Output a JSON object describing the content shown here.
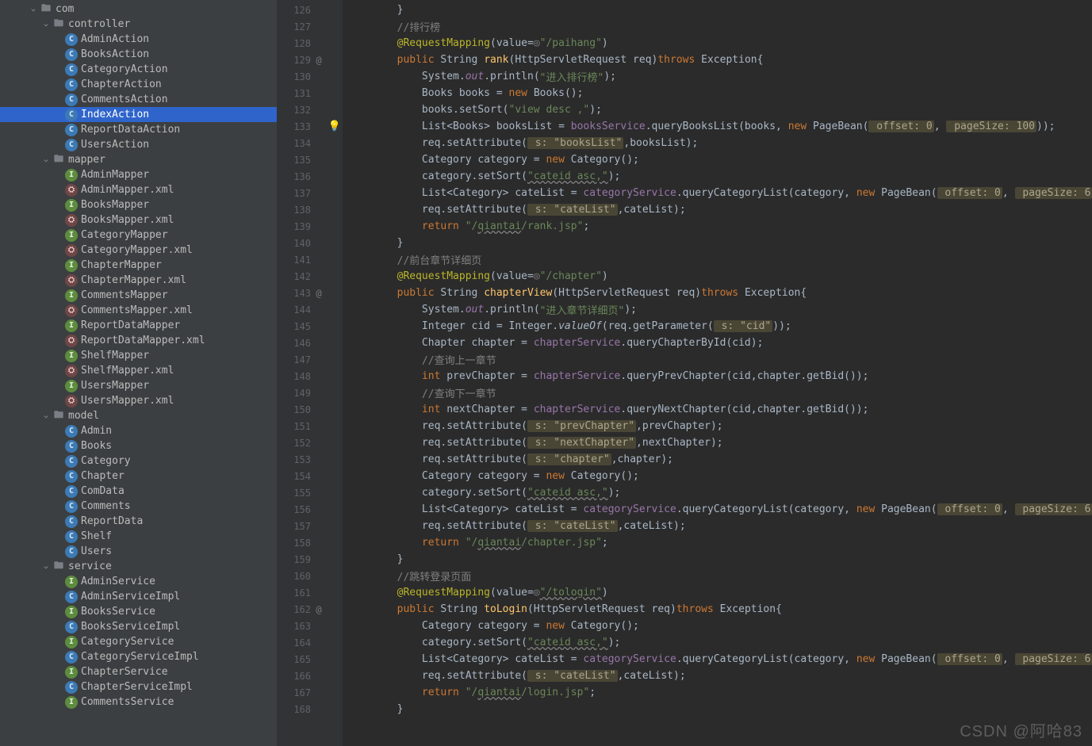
{
  "watermark": "CSDN @阿哈83",
  "tree": [
    {
      "indent": 2,
      "expanded": true,
      "iconType": "folder",
      "label": "com"
    },
    {
      "indent": 3,
      "expanded": true,
      "iconType": "folder",
      "label": "controller"
    },
    {
      "indent": 4,
      "iconType": "class",
      "label": "AdminAction"
    },
    {
      "indent": 4,
      "iconType": "class",
      "label": "BooksAction"
    },
    {
      "indent": 4,
      "iconType": "class",
      "label": "CategoryAction"
    },
    {
      "indent": 4,
      "iconType": "class",
      "label": "ChapterAction"
    },
    {
      "indent": 4,
      "iconType": "class",
      "label": "CommentsAction"
    },
    {
      "indent": 4,
      "iconType": "class",
      "label": "IndexAction",
      "selected": true
    },
    {
      "indent": 4,
      "iconType": "class",
      "label": "ReportDataAction"
    },
    {
      "indent": 4,
      "iconType": "class",
      "label": "UsersAction"
    },
    {
      "indent": 3,
      "expanded": true,
      "iconType": "folder",
      "label": "mapper"
    },
    {
      "indent": 4,
      "iconType": "interface",
      "label": "AdminMapper"
    },
    {
      "indent": 4,
      "iconType": "xml",
      "label": "AdminMapper.xml"
    },
    {
      "indent": 4,
      "iconType": "interface",
      "label": "BooksMapper"
    },
    {
      "indent": 4,
      "iconType": "xml",
      "label": "BooksMapper.xml"
    },
    {
      "indent": 4,
      "iconType": "interface",
      "label": "CategoryMapper"
    },
    {
      "indent": 4,
      "iconType": "xml",
      "label": "CategoryMapper.xml"
    },
    {
      "indent": 4,
      "iconType": "interface",
      "label": "ChapterMapper"
    },
    {
      "indent": 4,
      "iconType": "xml",
      "label": "ChapterMapper.xml"
    },
    {
      "indent": 4,
      "iconType": "interface",
      "label": "CommentsMapper"
    },
    {
      "indent": 4,
      "iconType": "xml",
      "label": "CommentsMapper.xml"
    },
    {
      "indent": 4,
      "iconType": "interface",
      "label": "ReportDataMapper"
    },
    {
      "indent": 4,
      "iconType": "xml",
      "label": "ReportDataMapper.xml"
    },
    {
      "indent": 4,
      "iconType": "interface",
      "label": "ShelfMapper"
    },
    {
      "indent": 4,
      "iconType": "xml",
      "label": "ShelfMapper.xml"
    },
    {
      "indent": 4,
      "iconType": "interface",
      "label": "UsersMapper"
    },
    {
      "indent": 4,
      "iconType": "xml",
      "label": "UsersMapper.xml"
    },
    {
      "indent": 3,
      "expanded": true,
      "iconType": "folder",
      "label": "model"
    },
    {
      "indent": 4,
      "iconType": "class",
      "label": "Admin"
    },
    {
      "indent": 4,
      "iconType": "class",
      "label": "Books"
    },
    {
      "indent": 4,
      "iconType": "class",
      "label": "Category"
    },
    {
      "indent": 4,
      "iconType": "class",
      "label": "Chapter"
    },
    {
      "indent": 4,
      "iconType": "class",
      "label": "ComData"
    },
    {
      "indent": 4,
      "iconType": "class",
      "label": "Comments"
    },
    {
      "indent": 4,
      "iconType": "class",
      "label": "ReportData"
    },
    {
      "indent": 4,
      "iconType": "class",
      "label": "Shelf"
    },
    {
      "indent": 4,
      "iconType": "class",
      "label": "Users"
    },
    {
      "indent": 3,
      "expanded": true,
      "iconType": "folder",
      "label": "service"
    },
    {
      "indent": 4,
      "iconType": "interface",
      "label": "AdminService"
    },
    {
      "indent": 4,
      "iconType": "class",
      "label": "AdminServiceImpl"
    },
    {
      "indent": 4,
      "iconType": "interface",
      "label": "BooksService"
    },
    {
      "indent": 4,
      "iconType": "class",
      "label": "BooksServiceImpl"
    },
    {
      "indent": 4,
      "iconType": "interface",
      "label": "CategoryService"
    },
    {
      "indent": 4,
      "iconType": "class",
      "label": "CategoryServiceImpl"
    },
    {
      "indent": 4,
      "iconType": "interface",
      "label": "ChapterService"
    },
    {
      "indent": 4,
      "iconType": "class",
      "label": "ChapterServiceImpl"
    },
    {
      "indent": 4,
      "iconType": "interface",
      "label": "CommentsService"
    }
  ],
  "code": [
    {
      "ln": 126,
      "indent": 1,
      "segs": [
        [
          "",
          "        }"
        ]
      ]
    },
    {
      "ln": 127,
      "indent": 1,
      "segs": [
        [
          "cm",
          "        //排行榜"
        ]
      ]
    },
    {
      "ln": 128,
      "indent": 1,
      "segs": [
        [
          "anno",
          "        @RequestMapping"
        ],
        [
          "",
          "(value="
        ],
        [
          "cm",
          "◎"
        ],
        [
          "str",
          "\"/paihang\""
        ],
        [
          "",
          ")"
        ]
      ]
    },
    {
      "ln": 129,
      "mark": "@",
      "indent": 1,
      "segs": [
        [
          "kw",
          "        public "
        ],
        [
          "",
          "String "
        ],
        [
          "fn",
          "rank"
        ],
        [
          "",
          "(HttpServletRequest req)"
        ],
        [
          "kw",
          "throws "
        ],
        [
          "",
          "Exception{"
        ]
      ]
    },
    {
      "ln": 130,
      "indent": 1,
      "segs": [
        [
          "",
          "            System."
        ],
        [
          "purple static",
          "out"
        ],
        [
          "",
          ".println("
        ],
        [
          "str",
          "\"进入排行榜\""
        ],
        [
          "",
          ");"
        ]
      ]
    },
    {
      "ln": 131,
      "indent": 1,
      "segs": [
        [
          "",
          "            Books books = "
        ],
        [
          "kw",
          "new "
        ],
        [
          "",
          "Books();"
        ]
      ]
    },
    {
      "ln": 132,
      "indent": 1,
      "segs": [
        [
          "",
          "            books.setSort("
        ],
        [
          "str",
          "\"view desc ,\""
        ],
        [
          "",
          ");"
        ]
      ]
    },
    {
      "ln": 133,
      "bulb": true,
      "indent": 1,
      "segs": [
        [
          "",
          "            List<Books> booksList = "
        ],
        [
          "purple",
          "booksService"
        ],
        [
          "",
          ".queryBooksList(books, "
        ],
        [
          "kw",
          "new "
        ],
        [
          "",
          "PageBean("
        ],
        [
          "hl-param",
          " offset: 0"
        ],
        [
          "",
          ", "
        ],
        [
          "hl-param",
          " pageSize: 100"
        ],
        [
          "",
          ")"
        ],
        [
          "",
          ");"
        ]
      ]
    },
    {
      "ln": 134,
      "indent": 1,
      "segs": [
        [
          "",
          "            req.setAttribute("
        ],
        [
          "hl-param",
          " s: \"booksList\""
        ],
        [
          "",
          ",booksList);"
        ]
      ]
    },
    {
      "ln": 135,
      "indent": 1,
      "segs": [
        [
          "",
          "            Category category = "
        ],
        [
          "kw",
          "new "
        ],
        [
          "",
          "Category();"
        ]
      ]
    },
    {
      "ln": 136,
      "indent": 1,
      "segs": [
        [
          "",
          "            category.setSort("
        ],
        [
          "hl-str-err",
          "\"cateid asc,\""
        ],
        [
          "",
          ");"
        ]
      ]
    },
    {
      "ln": 137,
      "indent": 1,
      "segs": [
        [
          "",
          "            List<Category> cateList = "
        ],
        [
          "purple",
          "categoryService"
        ],
        [
          "",
          ".queryCategoryList(category, "
        ],
        [
          "kw",
          "new "
        ],
        [
          "",
          "PageBean("
        ],
        [
          "hl-param",
          " offset: 0"
        ],
        [
          "",
          ", "
        ],
        [
          "hl-param",
          " pageSize: 6"
        ],
        [
          "",
          "));"
        ]
      ]
    },
    {
      "ln": 138,
      "indent": 1,
      "segs": [
        [
          "",
          "            req.setAttribute("
        ],
        [
          "hl-param",
          " s: \"cateList\""
        ],
        [
          "",
          ",cateList);"
        ]
      ]
    },
    {
      "ln": 139,
      "indent": 1,
      "segs": [
        [
          "kw",
          "            return "
        ],
        [
          "str",
          "\"/"
        ],
        [
          "hl-str-err",
          "qiantai"
        ],
        [
          "str",
          "/rank.jsp\""
        ],
        [
          "",
          ";"
        ]
      ]
    },
    {
      "ln": 140,
      "indent": 1,
      "segs": [
        [
          "",
          "        }"
        ]
      ]
    },
    {
      "ln": 141,
      "indent": 1,
      "segs": [
        [
          "cm",
          "        //前台章节详细页"
        ]
      ]
    },
    {
      "ln": 142,
      "indent": 1,
      "segs": [
        [
          "anno",
          "        @RequestMapping"
        ],
        [
          "",
          "(value="
        ],
        [
          "cm",
          "◎"
        ],
        [
          "str",
          "\"/chapter\""
        ],
        [
          "",
          ")"
        ]
      ]
    },
    {
      "ln": 143,
      "mark": "@",
      "indent": 1,
      "segs": [
        [
          "kw",
          "        public "
        ],
        [
          "",
          "String "
        ],
        [
          "fn",
          "chapterView"
        ],
        [
          "",
          "(HttpServletRequest req)"
        ],
        [
          "kw",
          "throws "
        ],
        [
          "",
          "Exception{"
        ]
      ]
    },
    {
      "ln": 144,
      "indent": 1,
      "segs": [
        [
          "",
          "            System."
        ],
        [
          "purple static",
          "out"
        ],
        [
          "",
          ".println("
        ],
        [
          "str",
          "\"进入章节详细页\""
        ],
        [
          "",
          ");"
        ]
      ]
    },
    {
      "ln": 145,
      "indent": 1,
      "segs": [
        [
          "",
          "            Integer cid = Integer."
        ],
        [
          "static",
          "valueOf"
        ],
        [
          "",
          "(req.getParameter("
        ],
        [
          "hl-param",
          " s: \"cid\""
        ],
        [
          "",
          "));"
        ]
      ]
    },
    {
      "ln": 146,
      "indent": 1,
      "segs": [
        [
          "",
          "            Chapter chapter = "
        ],
        [
          "purple",
          "chapterService"
        ],
        [
          "",
          ".queryChapterById(cid);"
        ]
      ]
    },
    {
      "ln": 147,
      "indent": 1,
      "segs": [
        [
          "cm",
          "            //查询上一章节"
        ]
      ]
    },
    {
      "ln": 148,
      "indent": 1,
      "segs": [
        [
          "kw",
          "            int "
        ],
        [
          "",
          "prevChapter = "
        ],
        [
          "purple",
          "chapterService"
        ],
        [
          "",
          ".queryPrevChapter(cid,chapter.getBid());"
        ]
      ]
    },
    {
      "ln": 149,
      "indent": 1,
      "segs": [
        [
          "cm",
          "            //查询下一章节"
        ]
      ]
    },
    {
      "ln": 150,
      "indent": 1,
      "segs": [
        [
          "kw",
          "            int "
        ],
        [
          "",
          "nextChapter = "
        ],
        [
          "purple",
          "chapterService"
        ],
        [
          "",
          ".queryNextChapter(cid,chapter.getBid());"
        ]
      ]
    },
    {
      "ln": 151,
      "indent": 1,
      "segs": [
        [
          "",
          "            req.setAttribute("
        ],
        [
          "hl-param",
          " s: \"prevChapter\""
        ],
        [
          "",
          ",prevChapter);"
        ]
      ]
    },
    {
      "ln": 152,
      "indent": 1,
      "segs": [
        [
          "",
          "            req.setAttribute("
        ],
        [
          "hl-param",
          " s: \"nextChapter\""
        ],
        [
          "",
          ",nextChapter);"
        ]
      ]
    },
    {
      "ln": 153,
      "indent": 1,
      "segs": [
        [
          "",
          "            req.setAttribute("
        ],
        [
          "hl-param",
          " s: \"chapter\""
        ],
        [
          "",
          ",chapter);"
        ]
      ]
    },
    {
      "ln": 154,
      "indent": 1,
      "segs": [
        [
          "",
          "            Category category = "
        ],
        [
          "kw",
          "new "
        ],
        [
          "",
          "Category();"
        ]
      ]
    },
    {
      "ln": 155,
      "indent": 1,
      "segs": [
        [
          "",
          "            category.setSort("
        ],
        [
          "hl-str-err",
          "\"cateid asc,\""
        ],
        [
          "",
          ");"
        ]
      ]
    },
    {
      "ln": 156,
      "indent": 1,
      "segs": [
        [
          "",
          "            List<Category> cateList = "
        ],
        [
          "purple",
          "categoryService"
        ],
        [
          "",
          ".queryCategoryList(category, "
        ],
        [
          "kw",
          "new "
        ],
        [
          "",
          "PageBean("
        ],
        [
          "hl-param",
          " offset: 0"
        ],
        [
          "",
          ", "
        ],
        [
          "hl-param",
          " pageSize: 6"
        ],
        [
          "",
          "));"
        ]
      ]
    },
    {
      "ln": 157,
      "indent": 1,
      "segs": [
        [
          "",
          "            req.setAttribute("
        ],
        [
          "hl-param",
          " s: \"cateList\""
        ],
        [
          "",
          ",cateList);"
        ]
      ]
    },
    {
      "ln": 158,
      "indent": 1,
      "segs": [
        [
          "kw",
          "            return "
        ],
        [
          "str",
          "\"/"
        ],
        [
          "hl-str-err",
          "qiantai"
        ],
        [
          "str",
          "/chapter.jsp\""
        ],
        [
          "",
          ";"
        ]
      ]
    },
    {
      "ln": 159,
      "indent": 1,
      "segs": [
        [
          "",
          "        }"
        ]
      ]
    },
    {
      "ln": 160,
      "indent": 1,
      "segs": [
        [
          "cm",
          "        //跳转登录页面"
        ]
      ]
    },
    {
      "ln": 161,
      "indent": 1,
      "segs": [
        [
          "anno",
          "        @RequestMapping"
        ],
        [
          "",
          "(value="
        ],
        [
          "cm",
          "◎"
        ],
        [
          "hl-str-err",
          "\"/tologin\""
        ],
        [
          "",
          ")"
        ]
      ]
    },
    {
      "ln": 162,
      "mark": "@",
      "indent": 1,
      "segs": [
        [
          "kw",
          "        public "
        ],
        [
          "",
          "String "
        ],
        [
          "fn",
          "toLogin"
        ],
        [
          "",
          "(HttpServletRequest req)"
        ],
        [
          "kw",
          "throws "
        ],
        [
          "",
          "Exception{"
        ]
      ]
    },
    {
      "ln": 163,
      "indent": 1,
      "segs": [
        [
          "",
          "            Category category = "
        ],
        [
          "kw",
          "new "
        ],
        [
          "",
          "Category();"
        ]
      ]
    },
    {
      "ln": 164,
      "indent": 1,
      "segs": [
        [
          "",
          "            category.setSort("
        ],
        [
          "hl-str-err",
          "\"cateid asc,\""
        ],
        [
          "",
          ");"
        ]
      ]
    },
    {
      "ln": 165,
      "indent": 1,
      "segs": [
        [
          "",
          "            List<Category> cateList = "
        ],
        [
          "purple",
          "categoryService"
        ],
        [
          "",
          ".queryCategoryList(category, "
        ],
        [
          "kw",
          "new "
        ],
        [
          "",
          "PageBean("
        ],
        [
          "hl-param",
          " offset: 0"
        ],
        [
          "",
          ", "
        ],
        [
          "hl-param",
          " pageSize: 6"
        ],
        [
          "",
          "));"
        ]
      ]
    },
    {
      "ln": 166,
      "indent": 1,
      "segs": [
        [
          "",
          "            req.setAttribute("
        ],
        [
          "hl-param",
          " s: \"cateList\""
        ],
        [
          "",
          ",cateList);"
        ]
      ]
    },
    {
      "ln": 167,
      "indent": 1,
      "segs": [
        [
          "kw",
          "            return "
        ],
        [
          "str",
          "\"/"
        ],
        [
          "hl-str-err",
          "qiantai"
        ],
        [
          "str",
          "/login.jsp\""
        ],
        [
          "",
          ";"
        ]
      ]
    },
    {
      "ln": 168,
      "indent": 1,
      "segs": [
        [
          "",
          "        }"
        ]
      ]
    }
  ]
}
